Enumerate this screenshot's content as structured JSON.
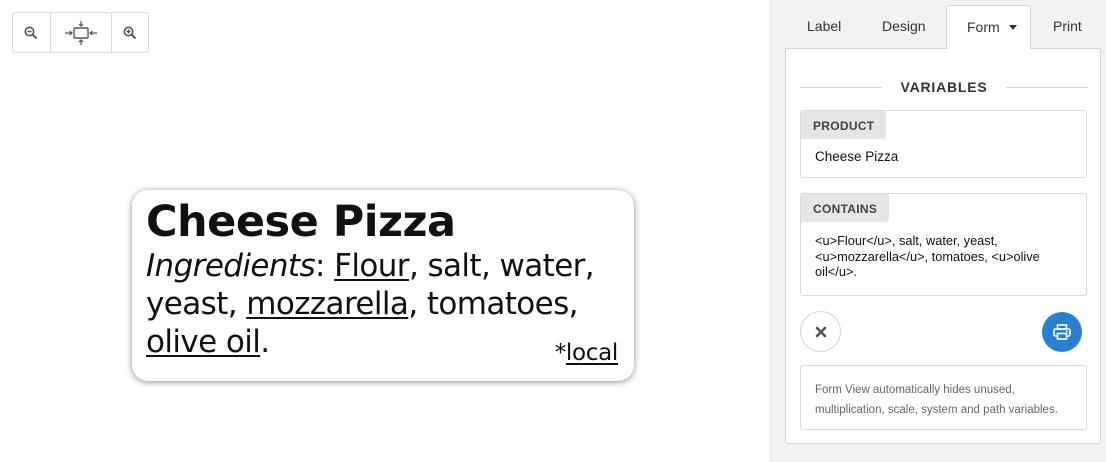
{
  "toolbar": {
    "zoom_out_icon": "zoom-out-icon",
    "fit_icon": "fit-to-view-icon",
    "zoom_in_icon": "zoom-in-icon"
  },
  "label": {
    "title": "Cheese Pizza",
    "ingredients_word": "Ingredients",
    "colon": ":",
    "items": [
      {
        "text": "Flour",
        "underline": true
      },
      {
        "text": ", salt, water, yeast, ",
        "underline": false
      },
      {
        "text": "mozzarella",
        "underline": true
      },
      {
        "text": ", tomatoes, ",
        "underline": false
      },
      {
        "text": "olive oil",
        "underline": true
      },
      {
        "text": ".",
        "underline": false
      }
    ],
    "local_prefix": "*",
    "local_word": "local"
  },
  "tabs": {
    "label": "Label",
    "design": "Design",
    "form": "Form",
    "print": "Print"
  },
  "form": {
    "section_title": "VARIABLES",
    "variables": {
      "product": {
        "name": "PRODUCT",
        "value": "Cheese Pizza"
      },
      "contains": {
        "name": "CONTAINS",
        "value": "<u>Flour</u>, salt, water, yeast, <u>mozzarella</u>, tomatoes, <u>olive oil</u>."
      }
    },
    "help_text": "Form View automatically hides unused, multiplication, scale, system and path variables."
  },
  "colors": {
    "print_button": "#2b7fd0",
    "panel_bg": "#f2f2f2",
    "icon_gray": "#555555"
  }
}
